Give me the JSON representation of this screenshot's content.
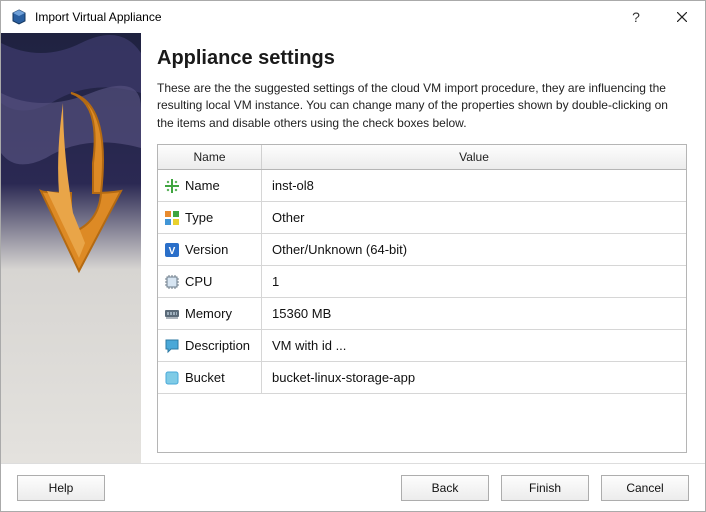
{
  "window": {
    "title": "Import Virtual Appliance"
  },
  "main": {
    "heading": "Appliance settings",
    "intro": "These are the the suggested settings of the cloud VM import procedure, they are influencing the resulting local VM instance. You can change many of the properties shown by double-clicking on the items and disable others using the check boxes below."
  },
  "table": {
    "headers": {
      "name": "Name",
      "value": "Value"
    },
    "rows": [
      {
        "icon": "name-icon",
        "label": "Name",
        "value": "inst-ol8"
      },
      {
        "icon": "type-icon",
        "label": "Type",
        "value": "Other"
      },
      {
        "icon": "version-icon",
        "label": "Version",
        "value": "Other/Unknown (64-bit)"
      },
      {
        "icon": "cpu-icon",
        "label": "CPU",
        "value": "1"
      },
      {
        "icon": "memory-icon",
        "label": "Memory",
        "value": "15360 MB"
      },
      {
        "icon": "description-icon",
        "label": "Description",
        "value": "VM with id ..."
      },
      {
        "icon": "bucket-icon",
        "label": "Bucket",
        "value": "bucket-linux-storage-app"
      }
    ]
  },
  "buttons": {
    "help": "Help",
    "back": "Back",
    "finish": "Finish",
    "cancel": "Cancel"
  }
}
